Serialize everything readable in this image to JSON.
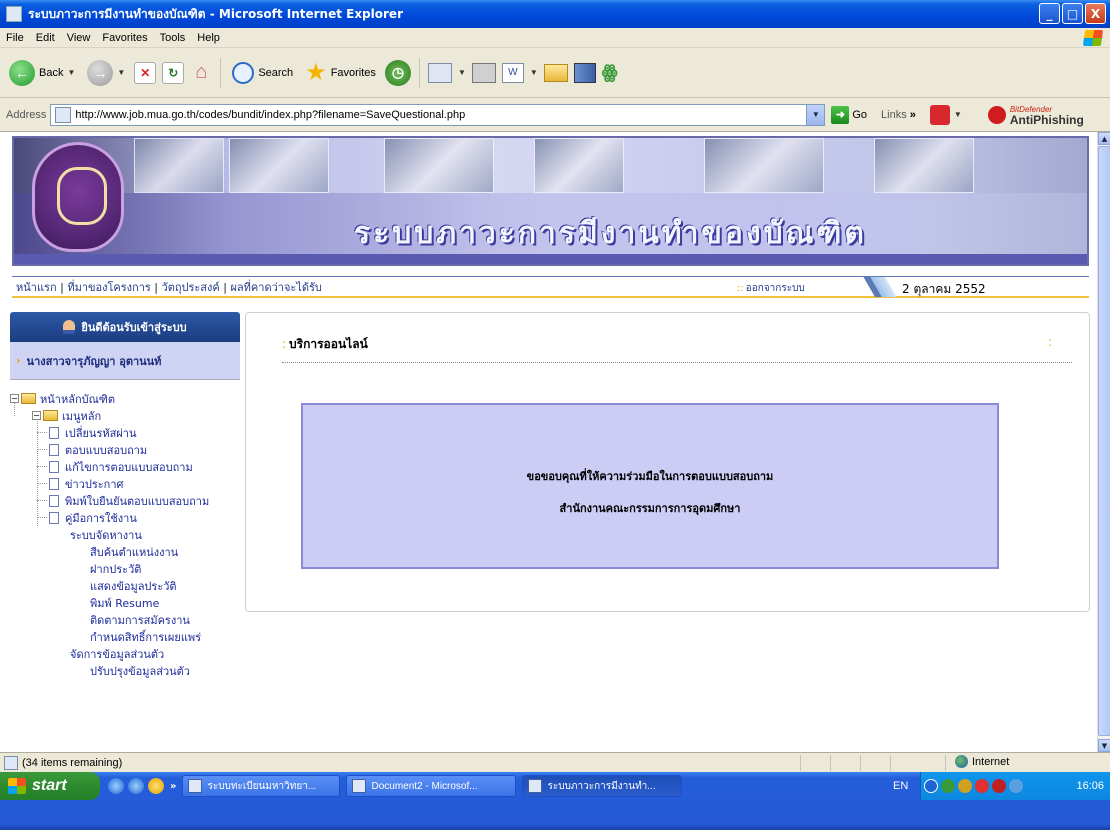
{
  "window": {
    "title": "ระบบภาวะการมีงานทำของบัณฑิต - Microsoft Internet Explorer",
    "controls": [
      "_",
      "□",
      "X"
    ]
  },
  "menu": [
    "File",
    "Edit",
    "View",
    "Favorites",
    "Tools",
    "Help"
  ],
  "toolbar": {
    "back_label": "Back",
    "search_label": "Search",
    "favorites_label": "Favorites"
  },
  "address": {
    "label": "Address",
    "url": "http://www.job.mua.go.th/codes/bundit/index.php?filename=SaveQuestional.php",
    "go_label": "Go",
    "links_label": "Links",
    "antiphishing_small": "BitDefender",
    "antiphishing_label": "AntiPhishing"
  },
  "banner": {
    "title": "ระบบภาวะการมีงานทำของบัณฑิต"
  },
  "nav": {
    "links": [
      "หน้าแรก",
      "ที่มาของโครงการ",
      "วัตถุประสงค์",
      "ผลที่คาดว่าจะได้รับ"
    ],
    "separator": "|",
    "logout": "ออกจากระบบ",
    "date": "2 ตุลาคม 2552"
  },
  "sidebar": {
    "welcome": "ยินดีต้อนรับเข้าสู่ระบบ",
    "username": "นางสาวจารุภัญญา อุตานนท์",
    "root": "หน้าหลักบัณฑิต",
    "menu_folder": "เมนูหลัก",
    "menu_items": [
      "เปลี่ยนรหัสผ่าน",
      "ตอบแบบสอบถาม",
      "แก้ไขการตอบแบบสอบถาม",
      "ข่าวประกาศ",
      "พิมพ์ใบยืนยันตอบแบบสอบถาม",
      "คู่มือการใช้งาน"
    ],
    "job_section": "ระบบจัดหางาน",
    "job_items": [
      "สืบค้นตำแหน่งงาน",
      "ฝากประวัติ",
      "แสดงข้อมูลประวัติ",
      "พิมพ์ Resume",
      "ติดตามการสมัครงาน",
      "กำหนดสิทธิ์การเผยแพร่"
    ],
    "personal_section": "จัดการข้อมูลส่วนตัว",
    "personal_items": [
      "ปรับปรุงข้อมูลส่วนตัว"
    ]
  },
  "main": {
    "header": "บริการออนไลน์",
    "marker": ":",
    "message_line1": "ขอขอบคุณที่ให้ความร่วมมือในการตอบแบบสอบถาม",
    "message_line2": "สำนักงานคณะกรรมการการอุดมศึกษา"
  },
  "status": {
    "text": "(34 items remaining)",
    "zone": "Internet"
  },
  "taskbar": {
    "start": "start",
    "tasks": [
      "ระบบทะเบียนมหาวิทยา...",
      "Document2 - Microsof...",
      "ระบบภาวะการมีงานทำ..."
    ],
    "lang": "EN",
    "clock": "16:06"
  },
  "colors": {
    "xp_blue": "#0048d8",
    "banner_purple": "#6a6aa8",
    "notice_bg": "#ccccf5",
    "link_blue": "#223c88",
    "accent_orange": "#e8a000"
  }
}
